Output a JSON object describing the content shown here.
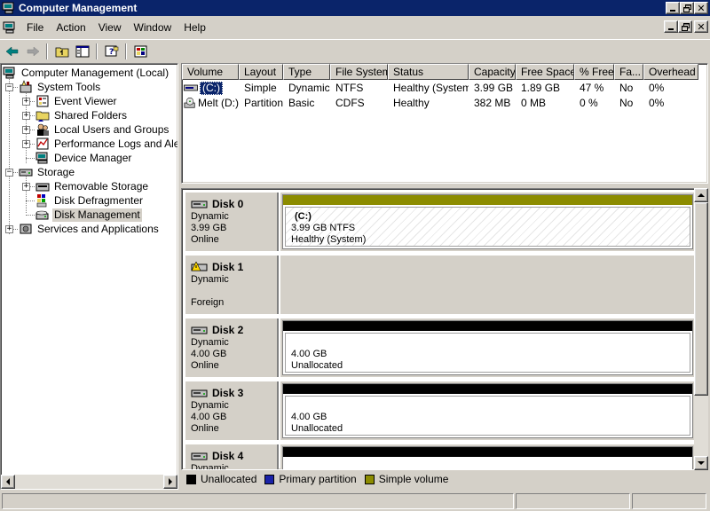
{
  "window": {
    "title": "Computer Management",
    "caption_buttons": [
      "minimize",
      "restore",
      "close"
    ]
  },
  "menu": {
    "items": [
      "File",
      "Action",
      "View",
      "Window",
      "Help"
    ]
  },
  "toolbar": {
    "buttons": [
      "back-icon",
      "forward-icon",
      "up-folder-icon",
      "show-hide-tree-icon",
      "help-icon",
      "properties-icon"
    ]
  },
  "tree": {
    "root": "Computer Management (Local)",
    "system_tools": "System Tools",
    "event_viewer": "Event Viewer",
    "shared_folders": "Shared Folders",
    "local_users": "Local Users and Groups",
    "perf_logs": "Performance Logs and Alerts",
    "device_manager": "Device Manager",
    "storage": "Storage",
    "removable_storage": "Removable Storage",
    "disk_defrag": "Disk Defragmenter",
    "disk_management": "Disk Management",
    "services_apps": "Services and Applications",
    "selected": "Disk Management"
  },
  "volume_list": {
    "columns": [
      "Volume",
      "Layout",
      "Type",
      "File System",
      "Status",
      "Capacity",
      "Free Space",
      "% Free",
      "Fa...",
      "Overhead"
    ],
    "rows": [
      {
        "volume": "(C:)",
        "layout": "Simple",
        "type": "Dynamic",
        "fs": "NTFS",
        "status": "Healthy (System)",
        "capacity": "3.99 GB",
        "free": "1.89 GB",
        "pct_free": "47 %",
        "fault": "No",
        "overhead": "0%"
      },
      {
        "volume": "Melt (D:)",
        "layout": "Partition",
        "type": "Basic",
        "fs": "CDFS",
        "status": "Healthy",
        "capacity": "382 MB",
        "free": "0 MB",
        "pct_free": "0 %",
        "fault": "No",
        "overhead": "0%"
      }
    ]
  },
  "disks": [
    {
      "name": "Disk 0",
      "type": "Dynamic",
      "size": "3.99 GB",
      "state": "Online",
      "part_label": "(C:)",
      "part_size": "3.99 GB NTFS",
      "part_status": "Healthy (System)",
      "bar_color": "#8c8c00"
    },
    {
      "name": "Disk 1",
      "type": "Dynamic",
      "size": "",
      "state": "Foreign"
    },
    {
      "name": "Disk 2",
      "type": "Dynamic",
      "size": "4.00 GB",
      "state": "Online",
      "part_size": "4.00 GB",
      "part_status": "Unallocated",
      "bar_color": "#000000"
    },
    {
      "name": "Disk 3",
      "type": "Dynamic",
      "size": "4.00 GB",
      "state": "Online",
      "part_size": "4.00 GB",
      "part_status": "Unallocated",
      "bar_color": "#000000"
    },
    {
      "name": "Disk 4",
      "type": "Dynamic",
      "bar_color": "#000000"
    }
  ],
  "legend": {
    "unallocated": "Unallocated",
    "primary": "Primary partition",
    "simple": "Simple volume",
    "colors": {
      "unallocated": "#000000",
      "primary": "#1a22a8",
      "simple": "#8c8c00"
    }
  }
}
